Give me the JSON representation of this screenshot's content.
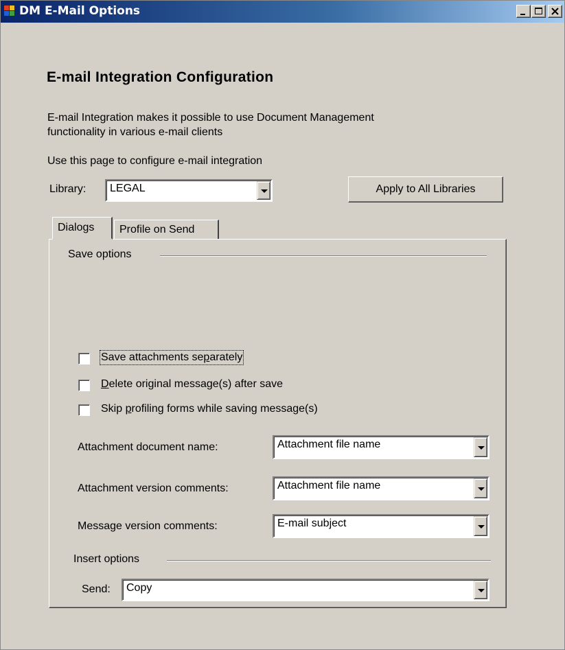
{
  "window": {
    "title": "DM E-Mail Options"
  },
  "page": {
    "heading": "E-mail Integration Configuration",
    "description_line1": "E-mail Integration makes it possible to use Document Management",
    "description_line2": "functionality in various e-mail clients",
    "instruction": "Use this page to configure e-mail integration"
  },
  "library": {
    "label": "Library:",
    "value": "LEGAL",
    "apply_all_label": "Apply to All Libraries"
  },
  "tabs": [
    {
      "label": "Dialogs",
      "active": true
    },
    {
      "label": "Profile on Send",
      "active": false
    }
  ],
  "save_options": {
    "group_label": "Save options",
    "checkboxes": [
      {
        "label_pre": "Save attachments se",
        "label_key": "p",
        "label_post": "arately",
        "checked": false
      },
      {
        "label_pre": "",
        "label_key": "D",
        "label_post": "elete original message(s) after save",
        "checked": false
      },
      {
        "label_pre": "Skip ",
        "label_key": "p",
        "label_post": "rofiling forms while saving message(s)",
        "checked": false
      }
    ],
    "attachment_doc_name_label": "Attachment document name:",
    "attachment_doc_name_value": "Attachment file name",
    "attachment_ver_comments_label": "Attachment version comments:",
    "attachment_ver_comments_value": "Attachment file name",
    "message_ver_comments_label": "Message version comments:",
    "message_ver_comments_value": "E-mail subject"
  },
  "insert_options": {
    "group_label": "Insert options",
    "send_label": "Send:",
    "send_value": "Copy"
  }
}
